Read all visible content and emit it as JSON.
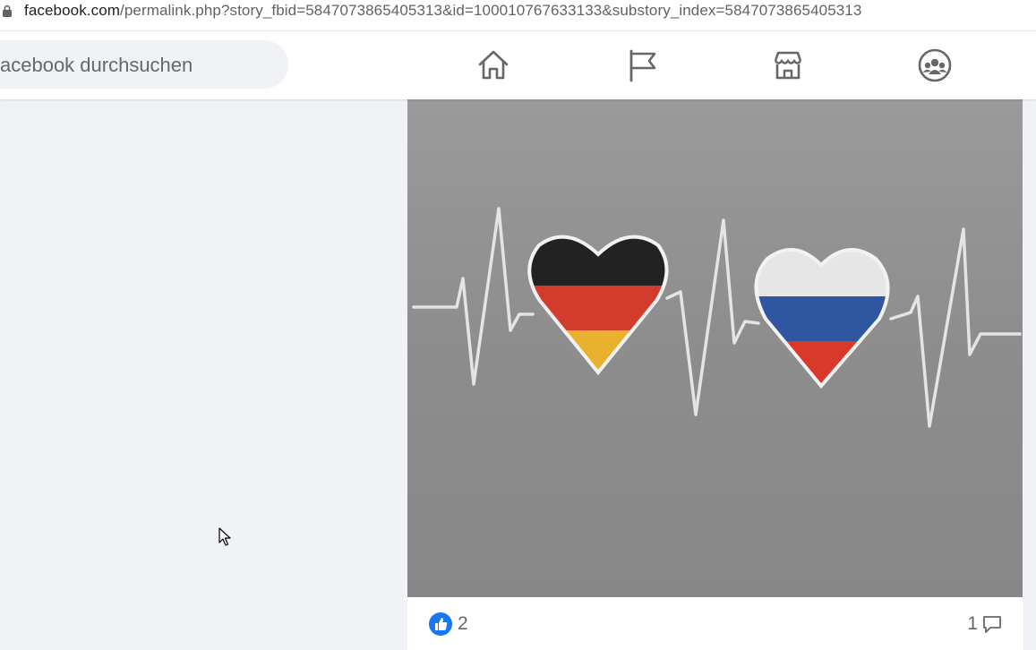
{
  "browser": {
    "url_host": "facebook.com",
    "url_path": "/permalink.php?story_fbid=5847073865405313&id=100010767633133&substory_index=5847073865405313"
  },
  "header": {
    "search_text": "acebook durchsuchen",
    "nav_items": [
      {
        "name": "home",
        "icon": "home-icon"
      },
      {
        "name": "pages",
        "icon": "flag-icon"
      },
      {
        "name": "marketplace",
        "icon": "store-icon"
      },
      {
        "name": "groups",
        "icon": "groups-icon"
      }
    ]
  },
  "post": {
    "image_description_icons": [
      "germany-heart",
      "russia-heart",
      "heartbeat-line"
    ],
    "like_count": "2",
    "comment_count": "1"
  },
  "colors": {
    "fb_blue": "#1877f2",
    "icon_gray": "#65676b",
    "page_bg": "#f0f2f5",
    "shirt_gray": "#8f8f8f"
  }
}
